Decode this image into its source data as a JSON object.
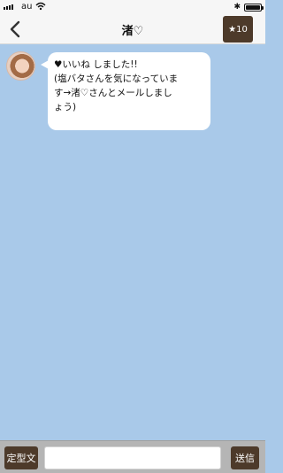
{
  "status_bar": {
    "carrier": "au",
    "bluetooth_icon": "bluetooth-icon",
    "battery_level": 1.0
  },
  "header": {
    "back_icon": "chevron-left-icon",
    "title": "渚♡",
    "favorite_label": "★10"
  },
  "chat": {
    "messages": [
      {
        "sender": "partner",
        "avatar_icon": "partner-avatar",
        "text": "♥いいね しました!!\n(塩バタさんを気になっていま\nす→渚♡さんとメールしまし\nょう)"
      }
    ]
  },
  "composer": {
    "template_label": "定型文",
    "input_value": "",
    "input_placeholder": "",
    "send_label": "送信"
  }
}
